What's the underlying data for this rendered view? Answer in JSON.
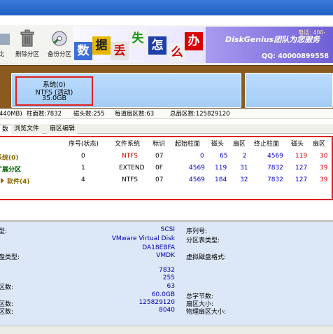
{
  "toolbar": {
    "prev_label": "比",
    "delete_label": "删除分区",
    "backup_label": "备份分区"
  },
  "banner": {
    "chars": [
      "数",
      "据",
      "丢",
      "失",
      "怎",
      "么",
      "办"
    ],
    "brand": "DiskGenius团队为您服务",
    "phone": "电话: 400-",
    "qq": "QQ: 40000899558"
  },
  "diskmap": {
    "partition_title": "系统(0)",
    "partition_fs": "NTFS (活动)",
    "partition_size": "35.0GB"
  },
  "infoline": {
    "capacity": "440MB)",
    "cylinders": "柱面数:7832",
    "heads": "磁头数:255",
    "sectors_per_track": "每道扇区数:63",
    "total_sectors": "总扇区数:125829120"
  },
  "tabs": [
    "数",
    "浏览文件",
    "扇区编辑"
  ],
  "table": {
    "headers": [
      "序号(状态)",
      "文件系统",
      "标识",
      "起始柱面",
      "磁头",
      "扇区",
      "终止柱面",
      "磁头",
      "扇区"
    ],
    "rows": [
      {
        "name": "系统(0)",
        "index": "0",
        "fs": "NTFS",
        "id": "07",
        "start_cyl": "0",
        "start_head": "65",
        "start_sec": "2",
        "end_cyl": "4569",
        "end_head": "119",
        "end_sec": "30"
      },
      {
        "name": "扩展分区",
        "index": "1",
        "fs": "EXTEND",
        "id": "0F",
        "start_cyl": "4569",
        "start_head": "119",
        "start_sec": "31",
        "end_cyl": "7832",
        "end_head": "127",
        "end_sec": "39"
      },
      {
        "name": "软件(4)",
        "index": "4",
        "fs": "NTFS",
        "id": "07",
        "start_cyl": "4569",
        "start_head": "184",
        "start_sec": "32",
        "end_cyl": "7832",
        "end_head": "127",
        "end_sec": "39"
      }
    ]
  },
  "details": {
    "left_labels": [
      "型:",
      "",
      "",
      "盘类型:",
      "",
      "",
      "区数:",
      "",
      "区数:",
      "区数:"
    ],
    "values": [
      "SCSI",
      "VMware Virtual Disk",
      "DA18EBFA",
      "VMDK",
      "",
      "7832",
      "255",
      "63",
      "60.0GB",
      "125829120",
      "8040"
    ],
    "right_labels": [
      "序列号:",
      "分区表类型:",
      "",
      "虚拟磁盘格式:",
      "",
      "",
      "",
      "总字节数:",
      "扇区大小:",
      "物理扇区大小:"
    ]
  },
  "colors": {
    "title_bar": "#2a6bd0",
    "disk_map_bg": "#8a5a1e",
    "partition_fill": "#b2d6fa",
    "highlight_box": "#e02020",
    "details_bg": "#dce7f7"
  }
}
